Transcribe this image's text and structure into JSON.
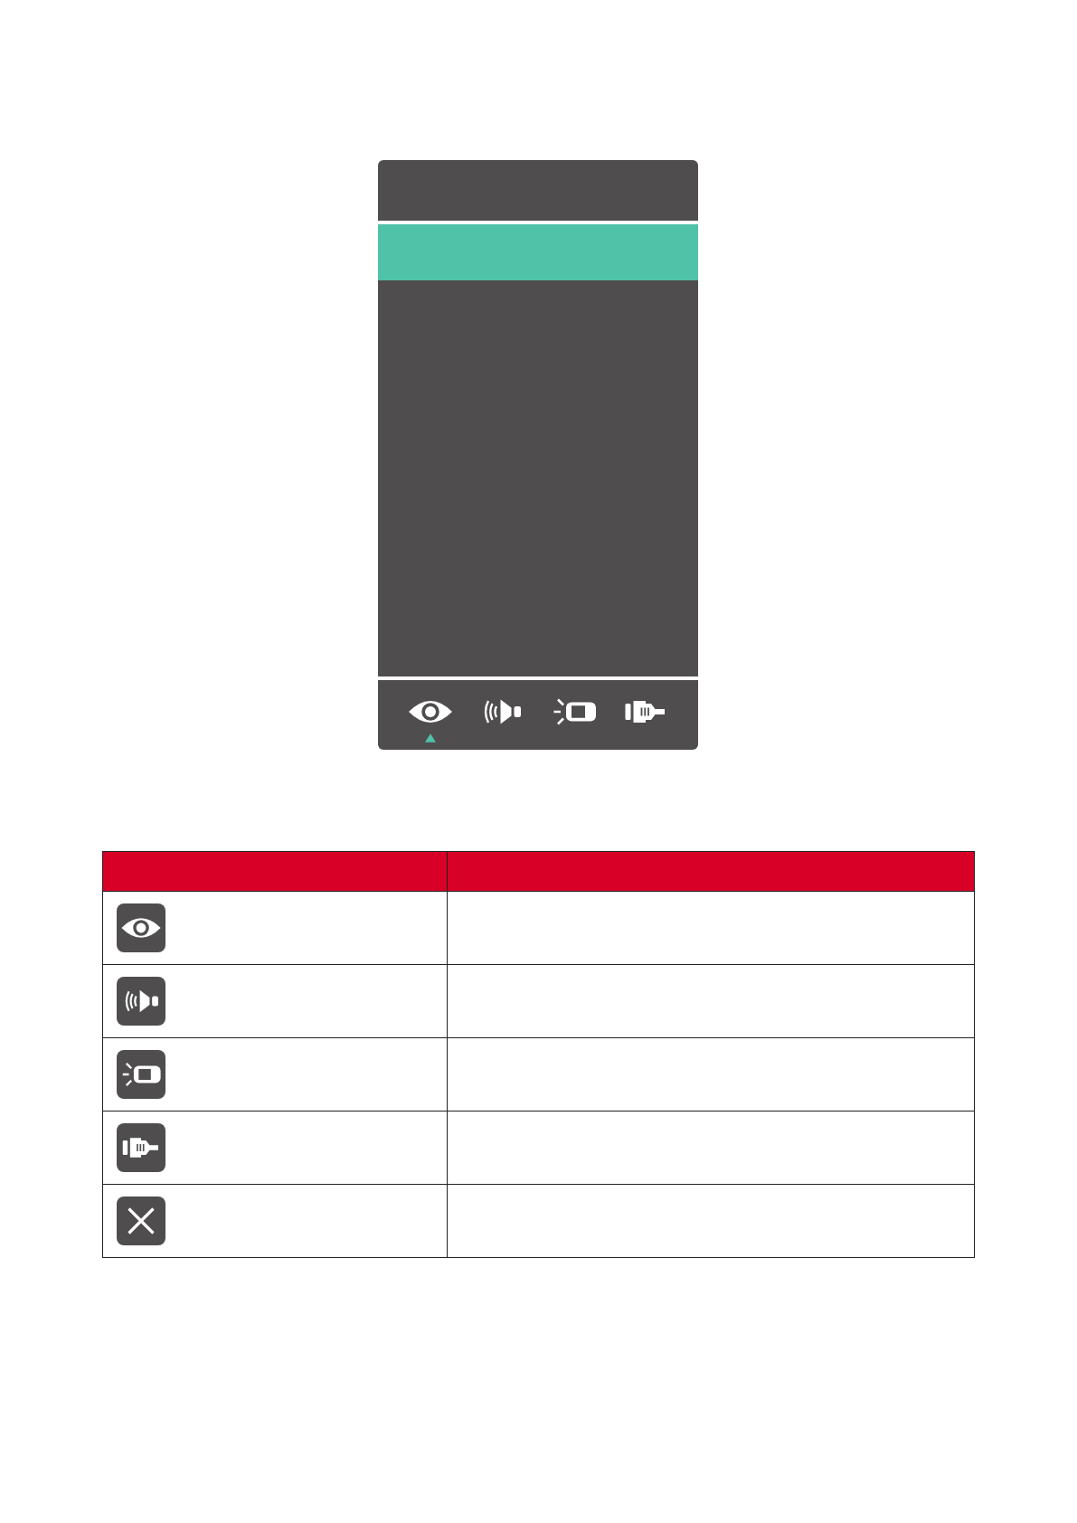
{
  "osd_menu": {
    "menu_items": [
      {
        "selected": true
      }
    ],
    "tabs": [
      {
        "kind": "eye",
        "selected": true
      },
      {
        "kind": "speaker",
        "selected": false
      },
      {
        "kind": "lamp",
        "selected": false
      },
      {
        "kind": "plug",
        "selected": false
      }
    ]
  },
  "legend_table": {
    "rows": [
      {
        "kind": "eye"
      },
      {
        "kind": "speaker"
      },
      {
        "kind": "lamp"
      },
      {
        "kind": "plug"
      },
      {
        "kind": "close"
      }
    ]
  }
}
